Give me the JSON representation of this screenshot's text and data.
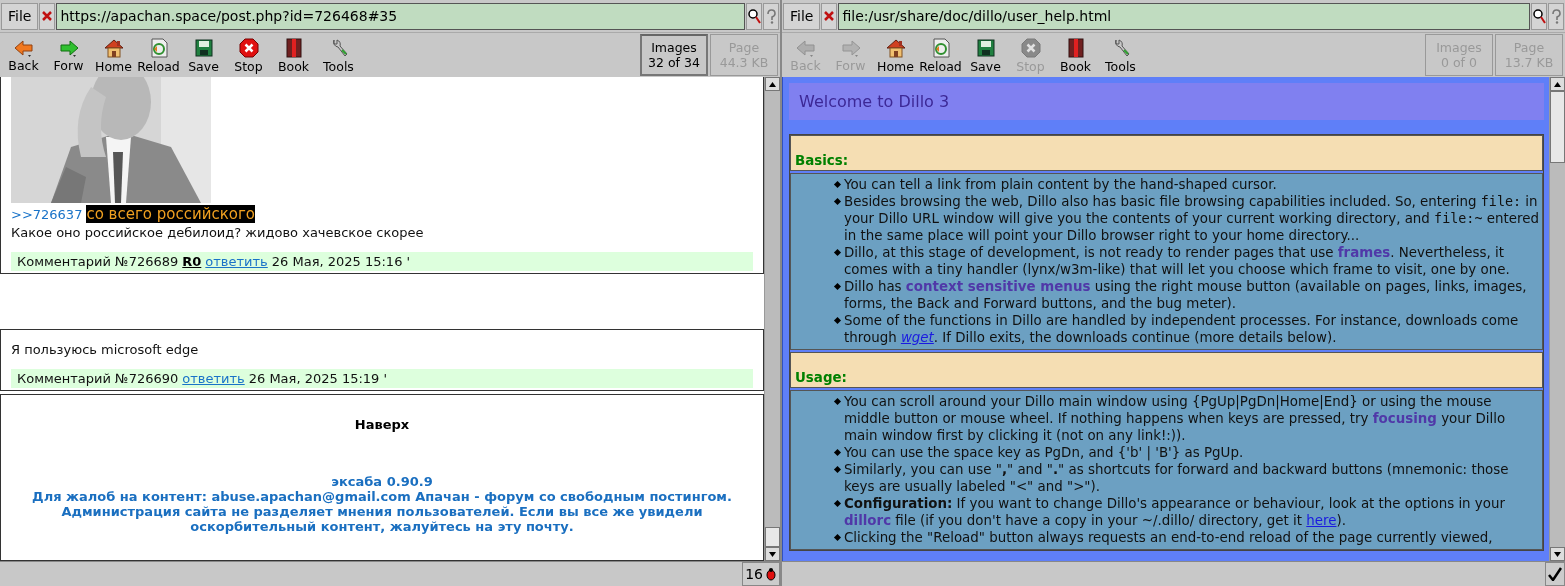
{
  "windows": [
    {
      "file_menu": "File",
      "url": "https://apachan.space/post.php?id=726468#35",
      "toolbar": [
        {
          "kind": "back",
          "label": "Back",
          "disabled": false
        },
        {
          "kind": "forward",
          "label": "Forw",
          "disabled": false
        },
        {
          "kind": "home",
          "label": "Home",
          "disabled": false
        },
        {
          "kind": "reload",
          "label": "Reload",
          "disabled": false
        },
        {
          "kind": "save",
          "label": "Save",
          "disabled": false
        },
        {
          "kind": "stop",
          "label": "Stop",
          "disabled": false
        },
        {
          "kind": "book",
          "label": "Book",
          "disabled": false
        },
        {
          "kind": "tools",
          "label": "Tools",
          "disabled": false
        }
      ],
      "meters": [
        {
          "label": "Images",
          "value": "32 of 34",
          "disabled": false
        },
        {
          "label": "Page",
          "value": "44.3 KB",
          "disabled": true
        }
      ],
      "page": {
        "kind": "forum",
        "posts": [
          {
            "reply_link": ">>726637",
            "quote": "со всего российского",
            "text": "Какое оно российское дебилоид? жидово хачевское скорее",
            "meta": {
              "number": "Комментарий №726689",
              "tag": "R0",
              "reply": "ответить",
              "date": "26 Мая, 2025 15:16 '"
            }
          },
          {
            "text": "Я пользуюсь microsoft edge",
            "meta": {
              "number": "Комментарий №726690",
              "reply": "ответить",
              "date": "26 Мая, 2025 15:19 '"
            }
          }
        ],
        "footer": {
          "top_link": "Наверх",
          "version": "эксаба 0.90.9",
          "notice": "Для жалоб на контент: abuse.apachan@gmail.com Апачан - форум со свободным постингом. Администрация сайта не разделяет мнения пользователей. Если вы все же увидели оскорбительный контент, жалуйтесь на эту почту."
        }
      },
      "status": {
        "kind": "bug",
        "count": "16"
      }
    },
    {
      "file_menu": "File",
      "url": "file:/usr/share/doc/dillo/user_help.html",
      "toolbar": [
        {
          "kind": "back",
          "label": "Back",
          "disabled": true
        },
        {
          "kind": "forward",
          "label": "Forw",
          "disabled": true
        },
        {
          "kind": "home",
          "label": "Home",
          "disabled": false
        },
        {
          "kind": "reload",
          "label": "Reload",
          "disabled": false
        },
        {
          "kind": "save",
          "label": "Save",
          "disabled": false
        },
        {
          "kind": "stop",
          "label": "Stop",
          "disabled": true
        },
        {
          "kind": "book",
          "label": "Book",
          "disabled": false
        },
        {
          "kind": "tools",
          "label": "Tools",
          "disabled": false
        }
      ],
      "meters": [
        {
          "label": "Images",
          "value": "0 of 0",
          "disabled": true
        },
        {
          "label": "Page",
          "value": "13.7 KB",
          "disabled": true
        }
      ],
      "page": {
        "kind": "help",
        "title": "Welcome to Dillo 3",
        "sections": [
          {
            "heading": "Basics:",
            "items": [
              [
                "You can tell a link from plain content by the hand-shaped cursor."
              ],
              [
                "Besides browsing the web, Dillo also has basic file browsing capabilities included. So, entering ",
                {
                  "text": "file:",
                  "kind": "mono"
                },
                " in your Dillo URL window will give you the contents of your current working directory, and ",
                {
                  "text": "file:~",
                  "kind": "mono"
                },
                " entered in the same place will point your Dillo browser right to your home directory..."
              ],
              [
                "Dillo, at this stage of development, is not ready to render pages that use ",
                {
                  "text": "frames",
                  "kind": "term"
                },
                ". Nevertheless, it comes with a tiny handler (lynx/w3m-like) that will let you choose which frame to visit, one by one."
              ],
              [
                "Dillo has ",
                {
                  "text": "context sensitive menus",
                  "kind": "term"
                },
                " using the right mouse button (available on pages, links, images, forms, the Back and Forward buttons, and the bug meter)."
              ],
              [
                "Some of the functions in Dillo are handled by independent processes. For instance, downloads come through ",
                {
                  "text": "wget",
                  "kind": "italic-link"
                },
                ". If Dillo exits, the downloads continue (more details below)."
              ]
            ]
          },
          {
            "heading": "Usage:",
            "items": [
              [
                "You can scroll around your Dillo main window using {PgUp|PgDn|Home|End} or using the mouse middle button or mouse wheel. If nothing happens when keys are pressed, try ",
                {
                  "text": "focusing",
                  "kind": "term"
                },
                " your Dillo main window first by clicking it (not on any link!:))."
              ],
              [
                "You can use the space key as PgDn, and {'b' | 'B'} as PgUp."
              ],
              [
                "Similarly, you can use \"",
                {
                  "text": ",",
                  "kind": "bold"
                },
                "\" and \"",
                {
                  "text": ".",
                  "kind": "bold"
                },
                "\" as shortcuts for forward and backward buttons (mnemonic: those keys are usually labeled \"<\" and \">\")."
              ],
              [
                {
                  "text": "Configuration:",
                  "kind": "bold"
                },
                " If you want to change Dillo's appearance or behaviour, look at the options in your ",
                {
                  "text": "dillorc",
                  "kind": "term"
                },
                " file (if you don't have a copy in your ~/.dillo/ directory, get it ",
                {
                  "text": "here",
                  "kind": "link"
                },
                ")."
              ],
              [
                "Clicking the \"Reload\" button always requests an end-to-end reload of the page currently viewed,"
              ]
            ]
          }
        ]
      },
      "status": {
        "kind": "ok"
      }
    }
  ]
}
